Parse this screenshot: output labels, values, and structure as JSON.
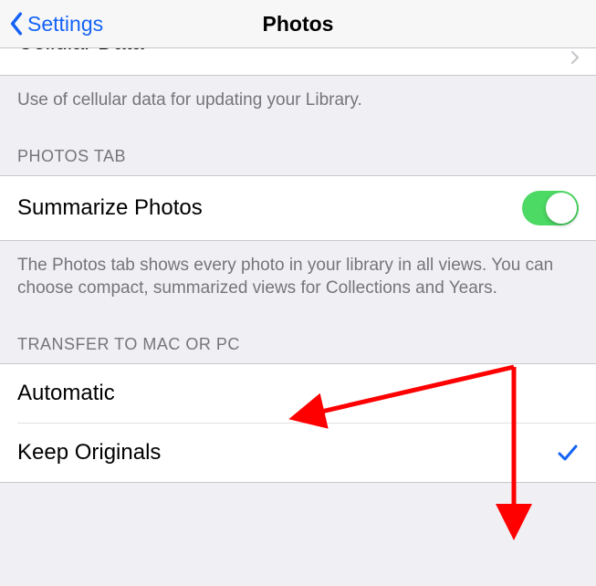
{
  "nav": {
    "back_label": "Settings",
    "title": "Photos"
  },
  "cellular": {
    "truncated_label": "Cellular Data",
    "footer": "Use of cellular data for updating your Library."
  },
  "photos_tab": {
    "header": "PHOTOS TAB",
    "summarize_label": "Summarize Photos",
    "summarize_on": true,
    "footer": "The Photos tab shows every photo in your library in all views. You can choose compact, summarized views for Collections and Years."
  },
  "transfer": {
    "header": "TRANSFER TO MAC OR PC",
    "options": [
      {
        "label": "Automatic",
        "selected": false
      },
      {
        "label": "Keep Originals",
        "selected": true
      }
    ]
  }
}
